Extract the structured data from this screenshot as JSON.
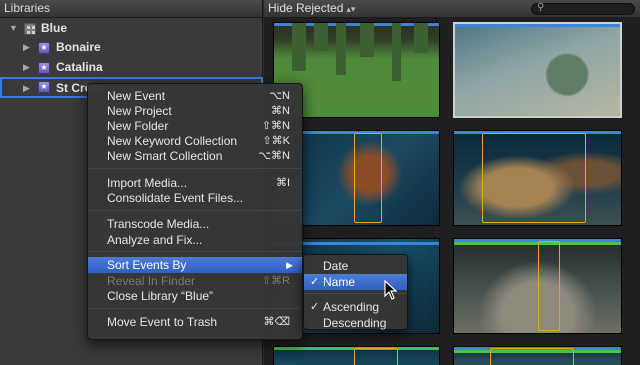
{
  "sidebar": {
    "header": "Libraries",
    "library": {
      "label": "Blue",
      "icon": "library-icon"
    },
    "events": [
      {
        "label": "Bonaire",
        "icon": "event-star-icon"
      },
      {
        "label": "Catalina",
        "icon": "event-star-icon"
      },
      {
        "label": "St Croix",
        "icon": "event-star-icon",
        "selected": true
      }
    ]
  },
  "browser": {
    "filter_label": "Hide Rejected",
    "filter_arrows": "▴▾",
    "search_icon": "search-icon"
  },
  "context_menu": {
    "items": [
      {
        "label": "New Event",
        "shortcut": "⌥N"
      },
      {
        "label": "New Project",
        "shortcut": "⌘N"
      },
      {
        "label": "New Folder",
        "shortcut": "⇧⌘N"
      },
      {
        "label": "New Keyword Collection",
        "shortcut": "⇧⌘K"
      },
      {
        "label": "New Smart Collection",
        "shortcut": "⌥⌘N"
      },
      {
        "label": "Import Media...",
        "shortcut": "⌘I"
      },
      {
        "label": "Consolidate Event Files...",
        "shortcut": ""
      },
      {
        "label": "Transcode Media...",
        "shortcut": ""
      },
      {
        "label": "Analyze and Fix...",
        "shortcut": ""
      },
      {
        "label": "Sort Events By",
        "shortcut": "▶",
        "highlighted": true
      },
      {
        "label": "Reveal In Finder",
        "shortcut": "⇧⌘R",
        "disabled": true
      },
      {
        "label": "Close Library “Blue”",
        "shortcut": ""
      },
      {
        "label": "Move Event to Trash",
        "shortcut": "⌘⌫"
      }
    ]
  },
  "submenu": {
    "items": [
      {
        "label": "Date",
        "checked": false
      },
      {
        "label": "Name",
        "checked": true,
        "highlighted": true
      },
      {
        "label": "Ascending",
        "checked": true
      },
      {
        "label": "Descending",
        "checked": false
      }
    ],
    "check_glyph": "✓"
  },
  "colors": {
    "selection_blue": "#3d7be0",
    "menu_highlight": "#3b6ccf",
    "range_orange": "#e2a81f"
  }
}
